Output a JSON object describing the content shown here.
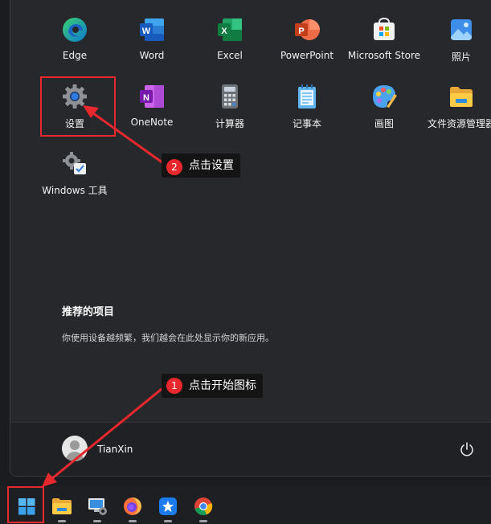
{
  "apps": [
    {
      "label": "Edge",
      "icon": "edge-icon"
    },
    {
      "label": "Word",
      "icon": "word-icon"
    },
    {
      "label": "Excel",
      "icon": "excel-icon"
    },
    {
      "label": "PowerPoint",
      "icon": "powerpoint-icon"
    },
    {
      "label": "Microsoft Store",
      "icon": "store-icon"
    },
    {
      "label": "照片",
      "icon": "photos-icon"
    },
    {
      "label": "设置",
      "icon": "gear-icon"
    },
    {
      "label": "OneNote",
      "icon": "onenote-icon"
    },
    {
      "label": "计算器",
      "icon": "calculator-icon"
    },
    {
      "label": "记事本",
      "icon": "notepad-icon"
    },
    {
      "label": "画图",
      "icon": "paint-icon"
    },
    {
      "label": "文件资源管理器",
      "icon": "folder-icon"
    },
    {
      "label": "Windows 工具",
      "icon": "windows-tools-icon"
    }
  ],
  "recommended": {
    "title": "推荐的项目",
    "description": "你使用设备越频繁，我们越会在此处显示你的新应用。"
  },
  "user": {
    "name": "TianXin"
  },
  "taskbar": [
    "start-icon",
    "file-explorer-icon",
    "control-panel-icon",
    "firefox-icon",
    "pin-app-icon",
    "chrome-icon"
  ],
  "annotations": [
    {
      "number": "1",
      "text": "点击开始图标"
    },
    {
      "number": "2",
      "text": "点击设置"
    }
  ],
  "colors": {
    "panel": "#27282b",
    "accent": "#e8282c",
    "taskbar": "#1e1f22"
  }
}
